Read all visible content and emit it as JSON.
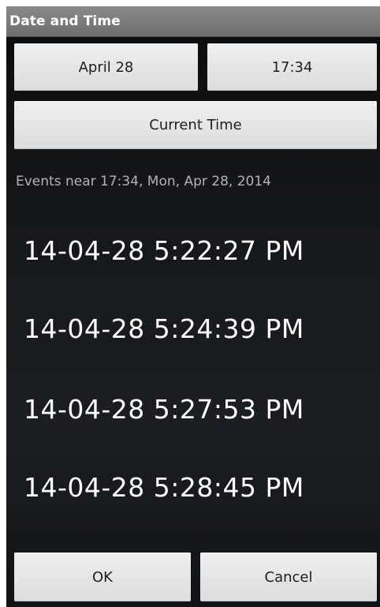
{
  "dialog": {
    "title": "Date and Time",
    "date_button": "April 28",
    "time_button": "17:34",
    "current_time_button": "Current Time",
    "events_label": "Events near 17:34, Mon, Apr 28, 2014",
    "events": [
      "14-04-28  5:22:27 PM",
      "14-04-28  5:24:39 PM",
      "14-04-28  5:27:53 PM",
      "14-04-28  5:28:45 PM"
    ],
    "ok_button": "OK",
    "cancel_button": "Cancel"
  },
  "colors": {
    "title_bar": "#7a7a7a",
    "background": "#16191c",
    "button": "#e4e4e4",
    "text_primary": "#ffffff",
    "text_secondary": "#b3b3b3"
  }
}
